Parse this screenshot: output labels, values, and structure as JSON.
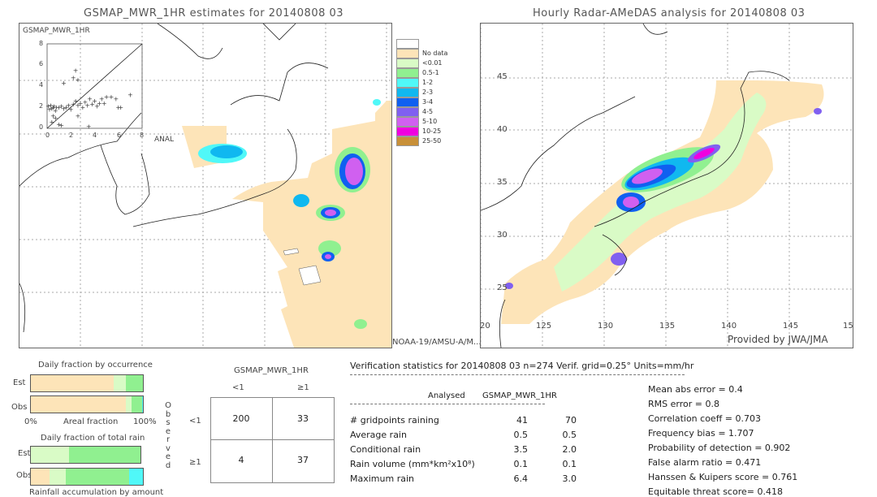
{
  "left_panel": {
    "title": "GSMAP_MWR_1HR estimates for 20140808 03",
    "inset_label": "GSMAP_MWR_1HR",
    "inset_y_ticks": [
      "8",
      "6",
      "4",
      "2",
      "0"
    ],
    "inset_x_ticks": [
      "0",
      "2",
      "4",
      "6",
      "8"
    ],
    "inset_x_label": "ANAL",
    "satellite_label": "NOAA-19/AMSU-A/M..."
  },
  "right_panel": {
    "title": "Hourly Radar-AMeDAS analysis for 20140808 03",
    "lat_ticks": [
      "45",
      "40",
      "35",
      "30",
      "25"
    ],
    "lon_ticks": [
      "20",
      "125",
      "130",
      "135",
      "140",
      "145",
      "15"
    ],
    "credit": "Provided by JWA/JMA"
  },
  "legend": {
    "items": [
      {
        "label": "",
        "color": "#ffffff"
      },
      {
        "label": "No data",
        "color": "#fde4b8"
      },
      {
        "label": "<0.01",
        "color": "#d9fbc6"
      },
      {
        "label": "0.5-1",
        "color": "#90f090"
      },
      {
        "label": "1-2",
        "color": "#50f8f8"
      },
      {
        "label": "2-3",
        "color": "#10b8f0"
      },
      {
        "label": "3-4",
        "color": "#1060f0"
      },
      {
        "label": "4-5",
        "color": "#8060f0"
      },
      {
        "label": "5-10",
        "color": "#d060f0"
      },
      {
        "label": "10-25",
        "color": "#f000e0"
      },
      {
        "label": "25-50",
        "color": "#c89038"
      }
    ]
  },
  "occurrence": {
    "title": "Daily fraction by occurrence",
    "est_label": "Est",
    "obs_label": "Obs",
    "axis_left": "0%",
    "axis_mid": "Areal fraction",
    "axis_right": "100%",
    "est_segments": [
      {
        "fraction": 0.74,
        "color": "#fde4b8"
      },
      {
        "fraction": 0.11,
        "color": "#d9fbc6"
      },
      {
        "fraction": 0.15,
        "color": "#90f090"
      }
    ],
    "obs_segments": [
      {
        "fraction": 0.85,
        "color": "#fde4b8"
      },
      {
        "fraction": 0.05,
        "color": "#d9fbc6"
      },
      {
        "fraction": 0.09,
        "color": "#90f090"
      },
      {
        "fraction": 0.01,
        "color": "#50f8f8"
      }
    ]
  },
  "total_rain": {
    "title": "Daily fraction of total rain",
    "est_label": "Est",
    "obs_label": "Obs",
    "footer": "Rainfall accumulation by amount",
    "est_segments": [
      {
        "fraction": 0.35,
        "color": "#d9fbc6"
      },
      {
        "fraction": 0.65,
        "color": "#90f090"
      }
    ],
    "obs_segments": [
      {
        "fraction": 0.17,
        "color": "#fde4b8"
      },
      {
        "fraction": 0.14,
        "color": "#d9fbc6"
      },
      {
        "fraction": 0.57,
        "color": "#90f090"
      },
      {
        "fraction": 0.12,
        "color": "#50f8f8"
      }
    ]
  },
  "contingency": {
    "header": "GSMAP_MWR_1HR",
    "col_labels": [
      "<1",
      "≥1"
    ],
    "row_labels": [
      "<1",
      "≥1"
    ],
    "observed_label": [
      "O",
      "b",
      "s",
      "e",
      "r",
      "v",
      "e",
      "d"
    ],
    "cells": [
      [
        "200",
        "33"
      ],
      [
        "4",
        "37"
      ]
    ]
  },
  "verification": {
    "header": "Verification statistics for 20140808 03   n=274   Verif. grid=0.25°   Units=mm/hr",
    "col_analysed": "Analysed",
    "col_est": "GSMAP_MWR_1HR",
    "rows": [
      {
        "label": "# gridpoints raining",
        "analysed": "41",
        "est": "70"
      },
      {
        "label": "Average rain",
        "analysed": "0.5",
        "est": "0.5"
      },
      {
        "label": "Conditional rain",
        "analysed": "3.5",
        "est": "2.0"
      },
      {
        "label": "Rain volume (mm*km²x10⁸)",
        "analysed": "0.1",
        "est": "0.1"
      },
      {
        "label": "Maximum rain",
        "analysed": "6.4",
        "est": "3.0"
      }
    ],
    "scores": [
      "Mean abs error = 0.4",
      "RMS error = 0.8",
      "Correlation coeff = 0.703",
      "Frequency bias = 1.707",
      "Probability of detection = 0.902",
      "False alarm ratio = 0.471",
      "Hanssen & Kuipers score = 0.761",
      "Equitable threat score= 0.418"
    ]
  },
  "chart_data": [
    {
      "type": "scatter",
      "title": "GSMAP_MWR_1HR",
      "xlabel": "ANAL",
      "ylabel": "GSMAP_MWR_1HR",
      "xlim": [
        0,
        8
      ],
      "ylim": [
        0,
        8
      ],
      "x_ticks": [
        0,
        2,
        4,
        6,
        8
      ],
      "y_ticks": [
        0,
        2,
        4,
        6,
        8
      ],
      "reference_line": "y=x",
      "points": [
        [
          0.1,
          2.1
        ],
        [
          0.2,
          1.8
        ],
        [
          0.3,
          2.2
        ],
        [
          0.4,
          1.9
        ],
        [
          0.5,
          2.0
        ],
        [
          0.6,
          2.1
        ],
        [
          0.7,
          1.7
        ],
        [
          0.8,
          2.0
        ],
        [
          1.0,
          2.0
        ],
        [
          1.2,
          2.1
        ],
        [
          1.4,
          1.9
        ],
        [
          1.6,
          2.0
        ],
        [
          1.8,
          2.2
        ],
        [
          2.0,
          1.8
        ],
        [
          2.2,
          2.3
        ],
        [
          2.4,
          2.6
        ],
        [
          2.6,
          2.2
        ],
        [
          2.8,
          2.4
        ],
        [
          3.0,
          2.0
        ],
        [
          3.2,
          2.5
        ],
        [
          3.4,
          2.2
        ],
        [
          3.6,
          2.8
        ],
        [
          3.8,
          2.3
        ],
        [
          4.0,
          2.6
        ],
        [
          4.2,
          2.1
        ],
        [
          4.4,
          2.4
        ],
        [
          4.6,
          2.8
        ],
        [
          4.8,
          2.4
        ],
        [
          5.0,
          3.0
        ],
        [
          5.4,
          3.0
        ],
        [
          5.8,
          2.8
        ],
        [
          6.0,
          2.0
        ],
        [
          6.2,
          2.0
        ],
        [
          7.0,
          3.2
        ],
        [
          0.5,
          1.2
        ],
        [
          0.7,
          1.0
        ],
        [
          1.0,
          0.4
        ],
        [
          1.2,
          0.3
        ],
        [
          0.4,
          0.6
        ],
        [
          2.2,
          4.8
        ],
        [
          2.6,
          4.6
        ],
        [
          2.4,
          5.5
        ],
        [
          1.4,
          4.3
        ],
        [
          2.6,
          1.2
        ],
        [
          3.5,
          0.2
        ]
      ]
    }
  ]
}
